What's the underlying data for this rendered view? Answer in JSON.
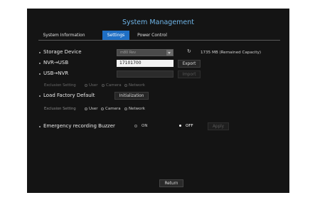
{
  "title": "System Management",
  "tabs": [
    {
      "label": "System Information"
    },
    {
      "label": "Settings"
    },
    {
      "label": "Power Control"
    }
  ],
  "storage": {
    "label": "Storage Device",
    "device": "m80 Rev",
    "capacity_text": "1735 MB (Remained Capacity)"
  },
  "nvr_usb": {
    "label": "NVR→USB",
    "value": "17101700",
    "export_label": "Export"
  },
  "usb_nvr": {
    "label": "USB→NVR",
    "import_label": "Import"
  },
  "exclusion1": {
    "label": "Exclusion Setting",
    "options": [
      "User",
      "Camera",
      "Network"
    ]
  },
  "factory": {
    "label": "Load Factory Default",
    "button_label": "Initialization"
  },
  "exclusion2": {
    "label": "Exclusion Setting",
    "options": [
      "User",
      "Camera",
      "Network"
    ]
  },
  "buzzer": {
    "label": "Emergency recording Buzzer",
    "on_label": "ON",
    "off_label": "OFF",
    "selected": "OFF",
    "apply_label": "Apply"
  },
  "return_label": "Return"
}
